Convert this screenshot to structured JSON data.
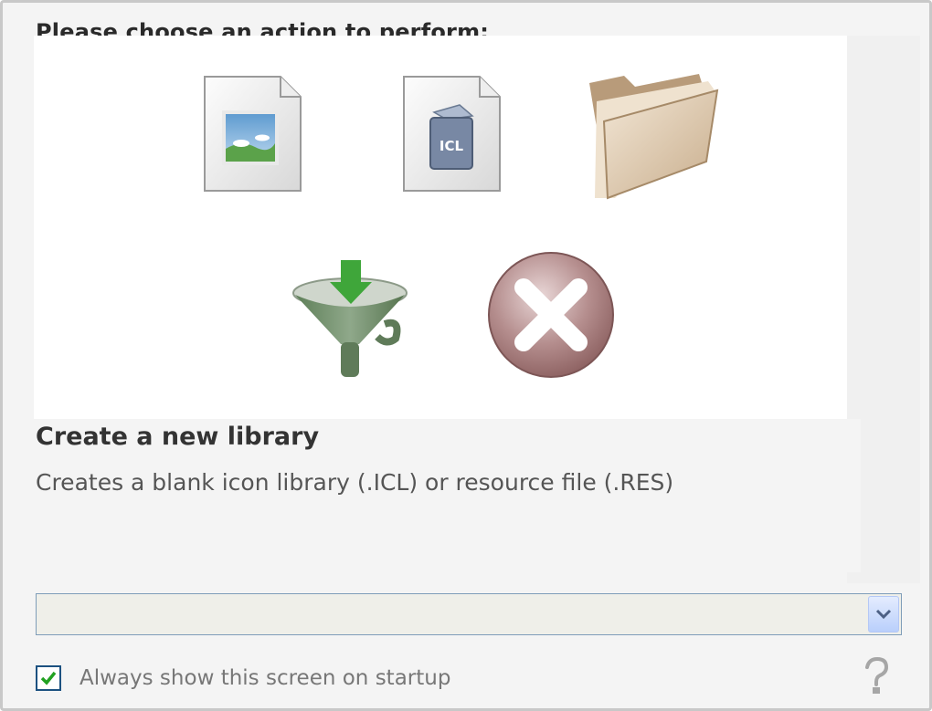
{
  "header": {
    "title": "Please choose an action to perform:"
  },
  "actions": [
    {
      "id": "create-icon",
      "icon": "image-document-icon"
    },
    {
      "id": "create-library",
      "icon": "icl-document-icon"
    },
    {
      "id": "open-file",
      "icon": "folder-icon"
    },
    {
      "id": "extract",
      "icon": "funnel-download-icon"
    },
    {
      "id": "close",
      "icon": "close-x-icon"
    }
  ],
  "description": {
    "title": "Create a new library",
    "text": "Creates a blank icon library (.ICL) or resource file (.RES)"
  },
  "recent_combo": {
    "value": ""
  },
  "startup": {
    "label": "Always show this screen on startup",
    "checked": true
  },
  "colors": {
    "checkmark": "#21a121",
    "funnel_arrow": "#3fa63a",
    "close_circle": "#a57a7a",
    "folder": "#d6c1a6"
  }
}
